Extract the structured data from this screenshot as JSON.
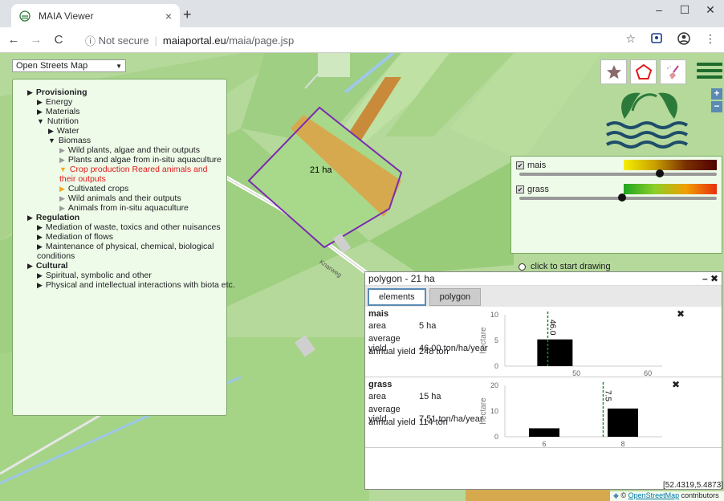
{
  "browser": {
    "tab_title": "MAIA Viewer",
    "tab_close": "×",
    "new_tab": "+",
    "security": "Not secure",
    "url_host": "maiaportal.eu",
    "url_path": "/maia/page.jsp",
    "back": "←",
    "forward": "→",
    "reload": "C",
    "info": "ⓘ",
    "bookmark": "☆",
    "menu": "⋮",
    "minimize": "–",
    "maximize": "☐",
    "close": "✕"
  },
  "map": {
    "basemap": "Open Streets Map",
    "polygon_label": "21 ha",
    "street_label": "Knarweg",
    "coords": "[52.4319,5.4873]",
    "attribution_prefix": "© ",
    "attribution_link": "OpenStreetMap",
    "attribution_suffix": " contributors",
    "zoom_in": "+",
    "zoom_out": "−"
  },
  "tree": {
    "provisioning": "Provisioning",
    "energy": "Energy",
    "materials": "Materials",
    "nutrition": "Nutrition",
    "water": "Water",
    "biomass": "Biomass",
    "wild_plants": "Wild plants, algae and their outputs",
    "plants_algae": "Plants and algae from in-situ aquaculture",
    "crop_production": "Crop production Reared animals and their outputs",
    "cultivated_crops": "Cultivated crops",
    "wild_animals": "Wild animals and their outputs",
    "animals_aquaculture": "Animals from in-situ aquaculture",
    "regulation": "Regulation",
    "mediation_waste": "Mediation of waste, toxics and other nuisances",
    "mediation_flows": "Mediation of flows",
    "maintenance": "Maintenance of physical, chemical, biological conditions",
    "cultural": "Cultural",
    "spiritual": "Spiritual, symbolic and other",
    "physical_intellectual": "Physical and intellectual interactions with biota etc."
  },
  "legend": {
    "layers": [
      {
        "name": "mais",
        "checked": true,
        "opacity": 0.72
      },
      {
        "name": "grass",
        "checked": true,
        "opacity": 0.52
      }
    ],
    "draw_hint": "click to start drawing"
  },
  "popup": {
    "title": "polygon - 21 ha",
    "controls": "– ✖",
    "tabs": [
      "elements",
      "polygon"
    ],
    "keys": {
      "area": "area",
      "yield": "average yield",
      "annual": "annual yield"
    },
    "crops": [
      {
        "name": "mais",
        "area": "5 ha",
        "avg_yield": "46.00 ton/ha/year",
        "annual_yield": "248 ton"
      },
      {
        "name": "grass",
        "area": "15 ha",
        "avg_yield": "7.51 ton/ha/year",
        "annual_yield": "114 ton"
      }
    ]
  },
  "chart_data": [
    {
      "type": "bar",
      "x": [
        47
      ],
      "values": [
        5.2
      ],
      "xlim": [
        40,
        62
      ],
      "ylim": [
        0,
        10
      ],
      "xticks": [
        50,
        60
      ],
      "yticks": [
        0,
        5,
        10
      ],
      "ylabel": "hectare",
      "marker_x": 46.0,
      "marker_label": "46.0"
    },
    {
      "type": "bar",
      "x": [
        6,
        8
      ],
      "values": [
        3.3,
        11
      ],
      "xlim": [
        5,
        9
      ],
      "ylim": [
        0,
        20
      ],
      "xticks": [
        6,
        8
      ],
      "yticks": [
        0,
        10,
        20
      ],
      "ylabel": "hectare",
      "marker_x": 7.5,
      "marker_label": "7.5"
    }
  ],
  "colors": {
    "accent_green": "#1e6b2e",
    "highlight_red": "#e0191b",
    "polygon_outline": "#7b2bb0",
    "mais_field": "#d7a94f",
    "grass_field": "#7cc764"
  }
}
